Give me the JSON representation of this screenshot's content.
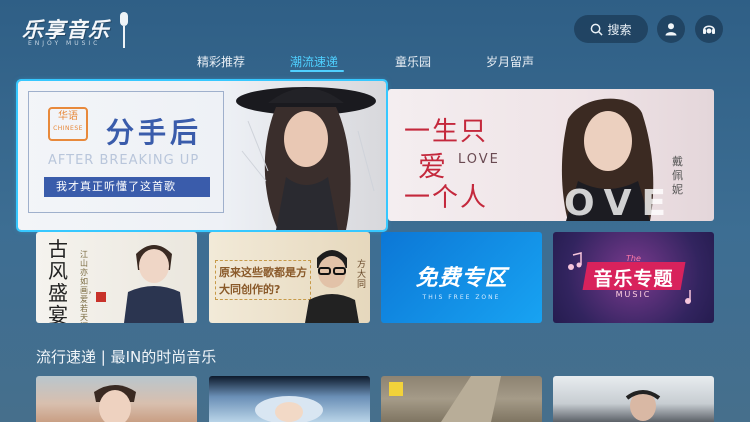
{
  "app": {
    "logo_text": "乐享音乐",
    "logo_sub": "ENJOY MUSIC"
  },
  "header": {
    "search_label": "搜索",
    "icons": [
      "search-icon",
      "user-icon",
      "headset-icon"
    ]
  },
  "nav": {
    "tabs": [
      {
        "label": "精彩推荐",
        "active": false
      },
      {
        "label": "潮流速递",
        "active": true
      },
      {
        "label": "童乐园",
        "active": false
      },
      {
        "label": "岁月留声",
        "active": false
      }
    ]
  },
  "banners": [
    {
      "badge_zh": "华语",
      "badge_en": "CHINESE",
      "title": "分手后",
      "subtitle_en": "AFTER BREAKING UP",
      "tagline": "我才真正听懂了这首歌",
      "focused": true
    },
    {
      "line1": "一生只",
      "line2": "爱",
      "love": "LOVE",
      "line3": "一个人",
      "artist": "戴佩妮",
      "overlay": "OVE"
    }
  ],
  "cards": [
    {
      "title": "古风盛宴",
      "subtitle": "江山亦如画，爱若天涯",
      "seal": "盛宴"
    },
    {
      "text": "原来这些歌都是方大同创作的?",
      "name": "方大同"
    },
    {
      "title": "免费专区",
      "subtitle": "THIS FREE ZONE"
    },
    {
      "title": "音乐专题",
      "the": "The",
      "music": "MUSIC"
    }
  ],
  "section": {
    "title": "流行速递 | 最IN的时尚音乐"
  },
  "colors": {
    "accent": "#4fd0ff",
    "focus_border": "#37c8ff",
    "background": "#3d6e93"
  }
}
